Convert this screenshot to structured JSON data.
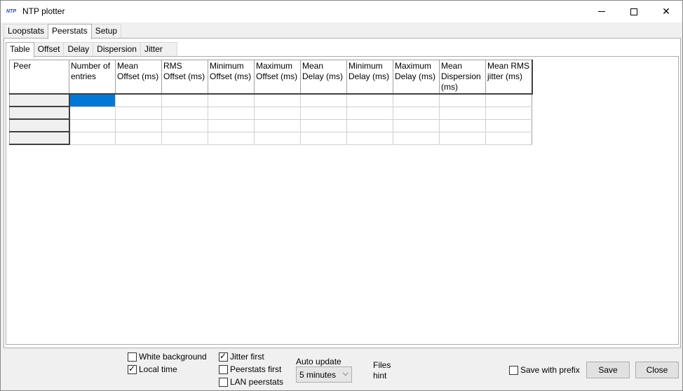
{
  "window": {
    "app_icon_text": "NTP",
    "title": "NTP plotter"
  },
  "outer_tabs": [
    "Loopstats",
    "Peerstats",
    "Setup"
  ],
  "outer_tab_active": "Peerstats",
  "inner_tabs": [
    "Table",
    "Offset",
    "Delay",
    "Dispersion",
    "Jitter"
  ],
  "inner_tab_active": "Table",
  "table": {
    "columns": [
      "Peer",
      "Number of entries",
      "Mean Offset (ms)",
      "RMS Offset (ms)",
      "Minimum Offset (ms)",
      "Maximum Offset (ms)",
      "Mean Delay (ms)",
      "Minimum Delay (ms)",
      "Maximum Delay (ms)",
      "Mean Dispersion (ms)",
      "Mean RMS jitter (ms)"
    ],
    "row_count": 4
  },
  "options": {
    "white_background": {
      "label": "White background",
      "checked": false
    },
    "local_time": {
      "label": "Local time",
      "checked": true
    },
    "jitter_first": {
      "label": "Jitter first",
      "checked": true
    },
    "peerstats_first": {
      "label": "Peerstats first",
      "checked": false
    },
    "lan_peerstats": {
      "label": "LAN peerstats",
      "checked": false
    },
    "save_with_prefix": {
      "label": "Save with prefix",
      "checked": false
    }
  },
  "auto_update": {
    "label": "Auto update",
    "value": "5 minutes"
  },
  "files_hint": {
    "line1": "Files",
    "line2": "hint"
  },
  "buttons": {
    "save": "Save",
    "close": "Close"
  }
}
